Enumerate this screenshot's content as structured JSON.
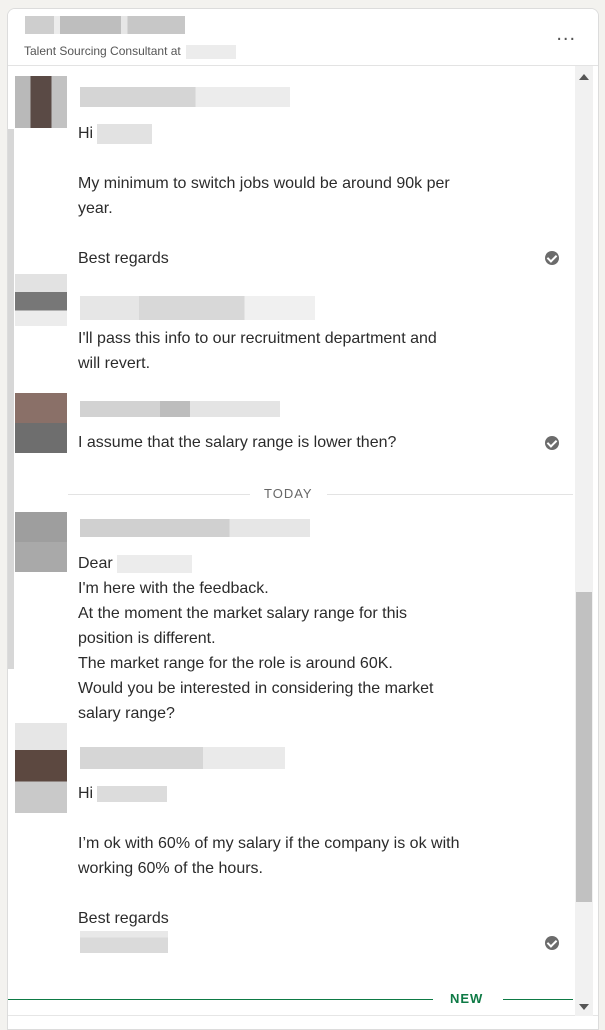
{
  "header": {
    "subtitle": "Talent Sourcing Consultant at",
    "more_icon": "..."
  },
  "messages": [
    {
      "lines": [
        "Hi",
        "",
        "My minimum to switch jobs would be around 90k per",
        "year.",
        "",
        "Best regards"
      ],
      "status": "read-check-icon"
    },
    {
      "lines": [
        "I'll pass this info to our recruitment department and",
        "will revert."
      ]
    },
    {
      "lines": [
        "I assume that the salary range is lower then?"
      ],
      "status": "read-check-icon"
    },
    {
      "lines": [
        "Dear",
        "I'm here with the feedback.",
        "At the moment the market salary range for this",
        "position is different.",
        "The market range for the role is around 60K.",
        "Would you be interested in considering the market",
        "salary range?"
      ]
    },
    {
      "lines": [
        "Hi",
        "",
        "I’m ok with 60% of my salary if the company is ok with",
        "working 60% of the hours.",
        "",
        "Best regards"
      ],
      "status": "read-check-icon"
    }
  ],
  "dividers": {
    "today": "TODAY",
    "new": "NEW"
  },
  "colors": {
    "accent_new": "#0e7a45",
    "text": "#2b2b2b",
    "check": "#6b6b6b"
  }
}
